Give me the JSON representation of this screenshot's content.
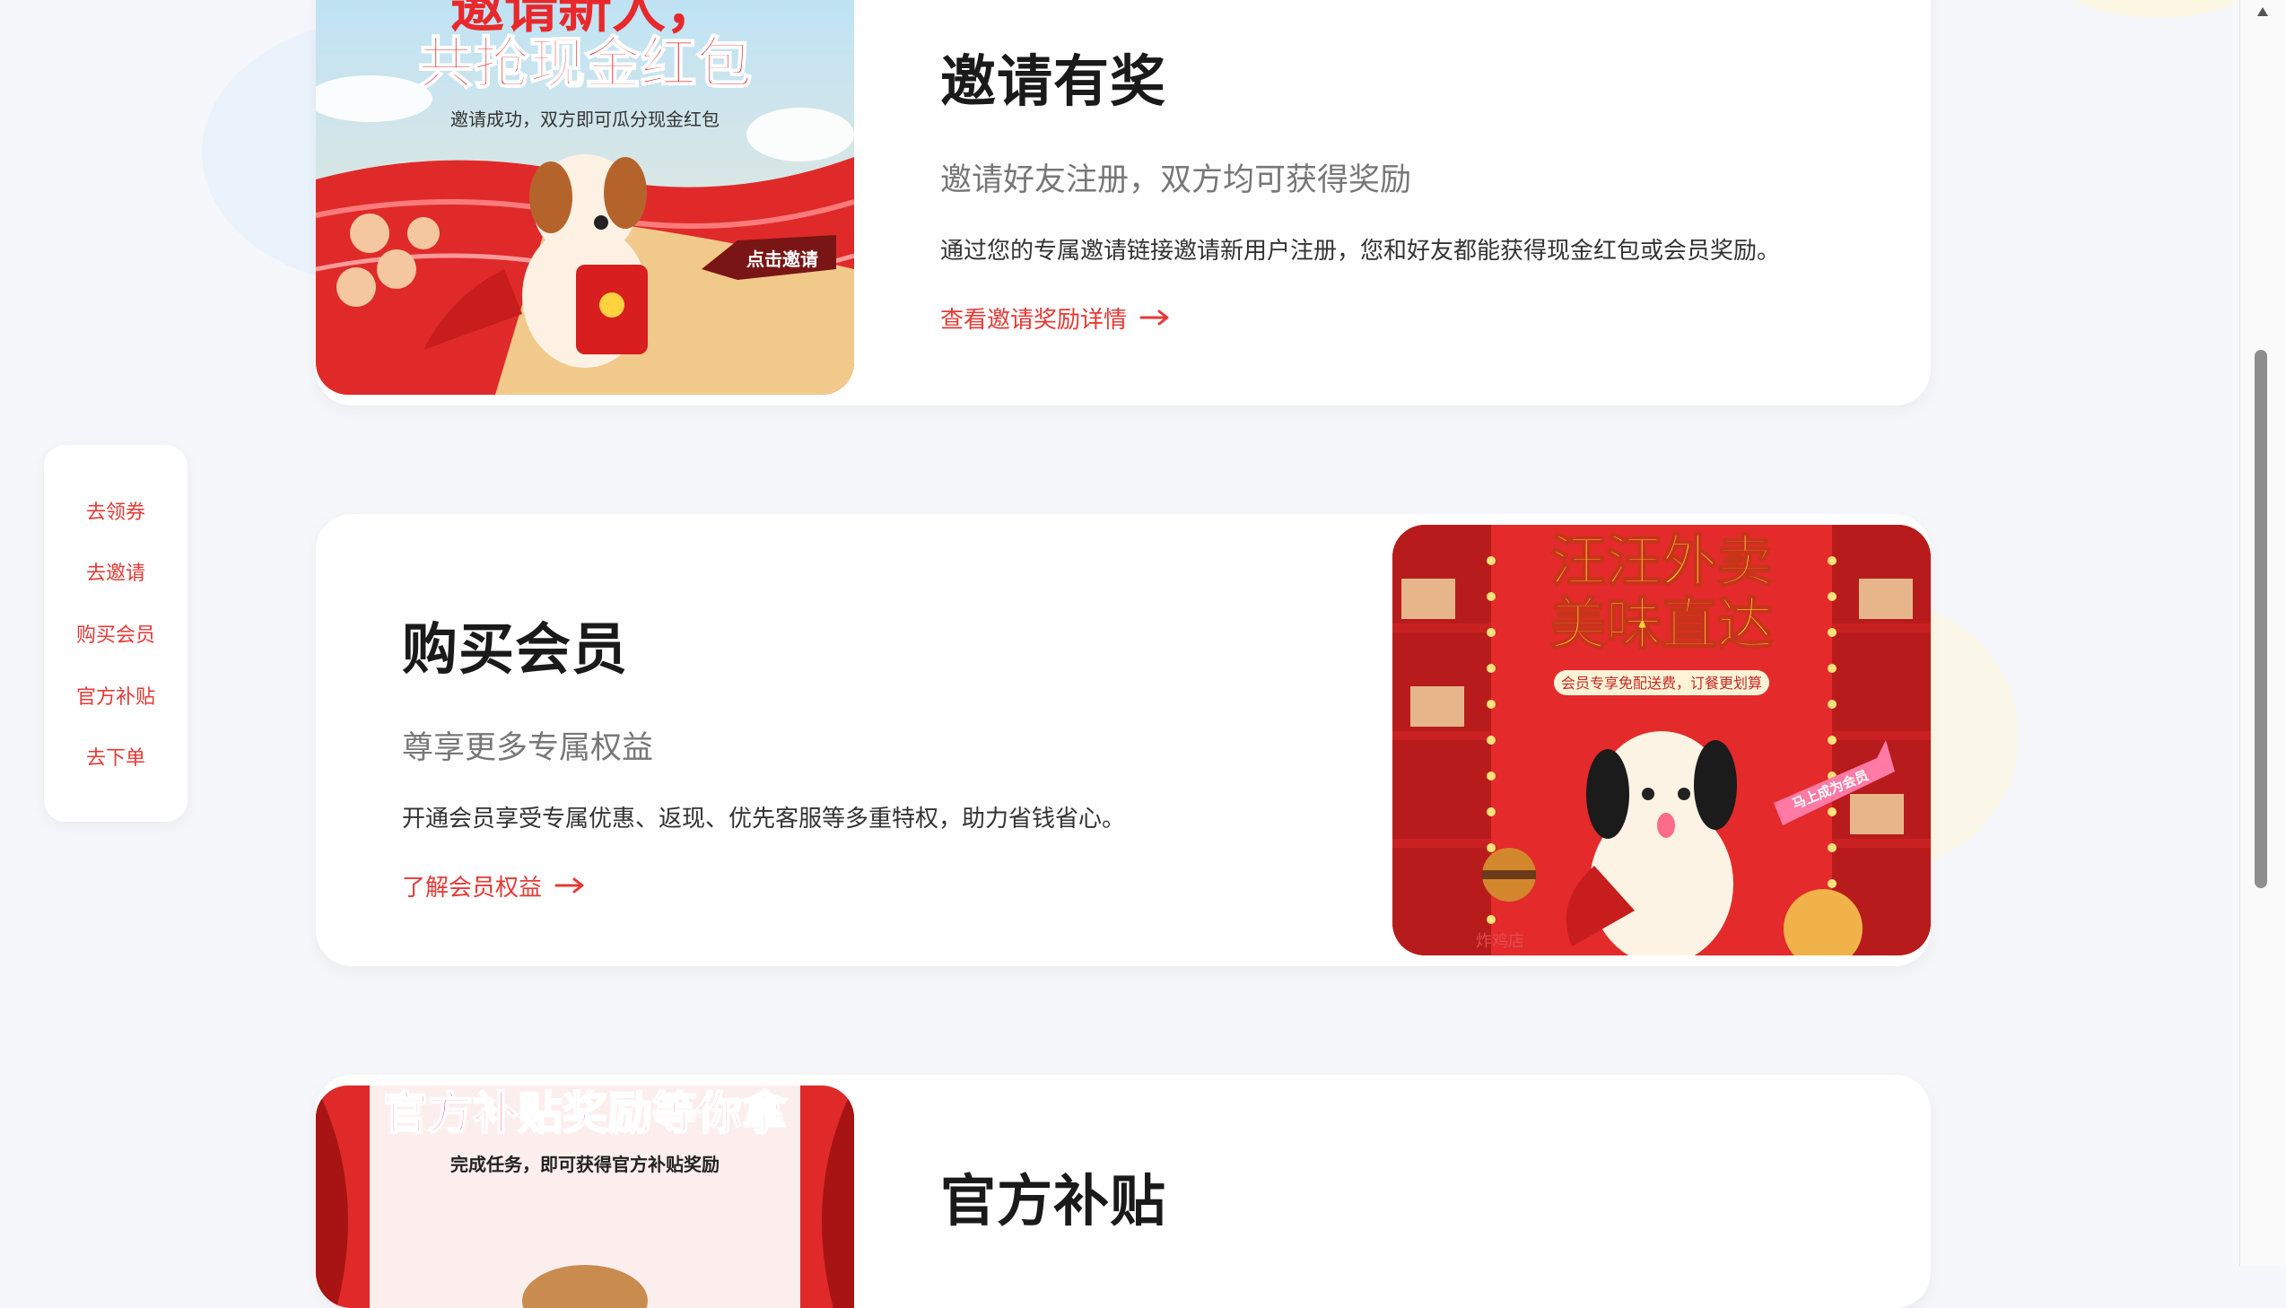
{
  "sidebar": {
    "items": [
      {
        "label": "去领券"
      },
      {
        "label": "去邀请"
      },
      {
        "label": "购买会员"
      },
      {
        "label": "官方补贴"
      },
      {
        "label": "去下单"
      }
    ]
  },
  "sections": {
    "invite": {
      "title": "邀请有奖",
      "subtitle": "邀请好友注册，双方均可获得奖励",
      "description": "通过您的专属邀请链接邀请新用户注册，您和好友都能获得现金红包或会员奖励。",
      "link": "查看邀请奖励详情",
      "banner": {
        "headline_top": "邀请新人，",
        "headline": "共抢现金红包",
        "caption": "邀请成功，双方即可瓜分现金红包",
        "badge": "点击邀请"
      }
    },
    "membership": {
      "title": "购买会员",
      "subtitle": "尊享更多专属权益",
      "description": "开通会员享受专属优惠、返现、优先客服等多重特权，助力省钱省心。",
      "link": "了解会员权益",
      "banner": {
        "headline_line1": "汪汪外卖",
        "headline_line2": "美味直达",
        "caption": "会员专享免配送费，订餐更划算",
        "badge": "马上成为会员",
        "sign": "炸鸡店"
      }
    },
    "subsidy": {
      "title": "官方补贴",
      "banner": {
        "headline": "官方补贴奖励等你拿",
        "caption": "完成任务，即可获得官方补贴奖励"
      }
    }
  },
  "colors": {
    "accent": "#e53935",
    "page_bg": "#f6f7fa",
    "card_bg": "#ffffff",
    "title": "#1a1a1a",
    "subtitle": "#777777"
  },
  "icons": {
    "link_arrow": "arrow-right-icon",
    "scroll_up": "caret-up-icon"
  }
}
